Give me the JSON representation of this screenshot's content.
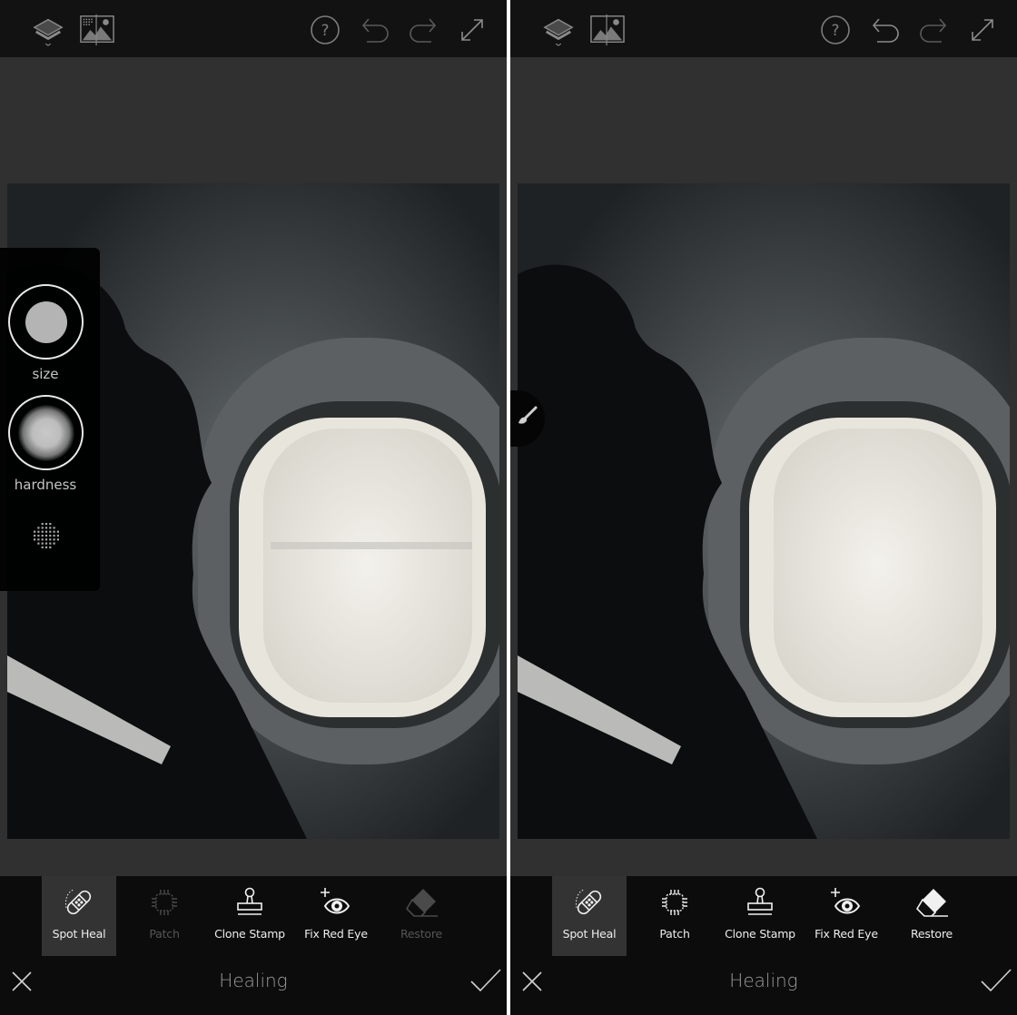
{
  "panels": [
    {
      "id": "before",
      "topbar": {
        "icons": [
          "layers-icon",
          "compare-image-icon",
          "help-icon",
          "undo-icon",
          "redo-icon",
          "fullscreen-icon"
        ]
      },
      "brush_panel": {
        "visible": true,
        "size_label": "size",
        "hardness_label": "hardness"
      },
      "tools": [
        {
          "label": "Spot Heal",
          "icon": "bandage-icon",
          "state": "active"
        },
        {
          "label": "Patch",
          "icon": "patch-icon",
          "state": "disabled"
        },
        {
          "label": "Clone Stamp",
          "icon": "stamp-icon",
          "state": "enabled"
        },
        {
          "label": "Fix Red Eye",
          "icon": "eye-plus-icon",
          "state": "enabled"
        },
        {
          "label": "Restore",
          "icon": "eraser-icon",
          "state": "disabled"
        }
      ],
      "bottom": {
        "title": "Healing",
        "cancel_icon": "close-icon",
        "confirm_icon": "checkmark-icon"
      }
    },
    {
      "id": "after",
      "topbar": {
        "icons": [
          "layers-icon",
          "compare-image-icon",
          "help-icon",
          "undo-icon",
          "redo-icon",
          "fullscreen-icon"
        ]
      },
      "brush_panel": {
        "visible": false,
        "tab_icon": "brush-icon"
      },
      "tools": [
        {
          "label": "Spot Heal",
          "icon": "bandage-icon",
          "state": "active"
        },
        {
          "label": "Patch",
          "icon": "patch-icon",
          "state": "enabled"
        },
        {
          "label": "Clone Stamp",
          "icon": "stamp-icon",
          "state": "enabled"
        },
        {
          "label": "Fix Red Eye",
          "icon": "eye-plus-icon",
          "state": "enabled"
        },
        {
          "label": "Restore",
          "icon": "eraser-icon",
          "state": "enabled"
        }
      ],
      "bottom": {
        "title": "Healing",
        "cancel_icon": "close-icon",
        "confirm_icon": "checkmark-icon"
      }
    }
  ],
  "photo": {
    "subject": "passenger silhouette beside airplane window",
    "tone": "monochrome"
  },
  "colors": {
    "topbar_bg": "#121212",
    "canvas_bg": "#303030",
    "toolbar_bg": "#0c0c0c",
    "active_tool_bg": "#333333",
    "text_enabled": "#ededed",
    "text_disabled": "#555555",
    "title_text": "#9a9a9a"
  }
}
